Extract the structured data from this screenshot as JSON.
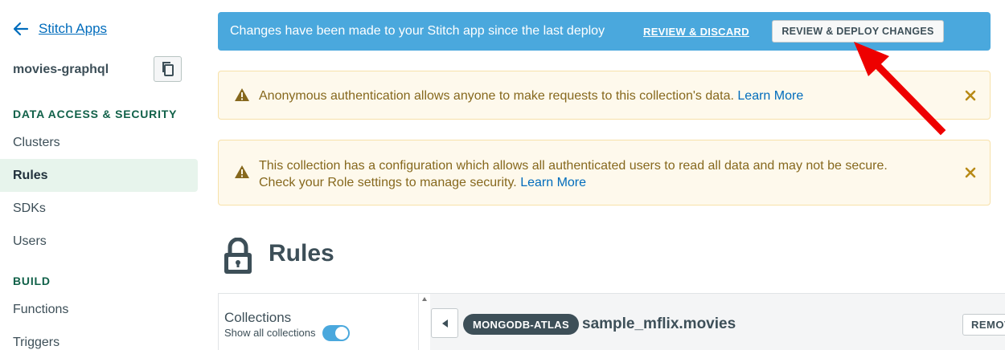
{
  "sidebar": {
    "back_label": "Stitch Apps",
    "app_name": "movies-graphql",
    "sections": [
      {
        "title": "DATA ACCESS & SECURITY",
        "items": [
          {
            "label": "Clusters"
          },
          {
            "label": "Rules",
            "active": true
          },
          {
            "label": "SDKs"
          },
          {
            "label": "Users"
          }
        ]
      },
      {
        "title": "BUILD",
        "items": [
          {
            "label": "Functions"
          },
          {
            "label": "Triggers"
          }
        ]
      }
    ]
  },
  "deploy_banner": {
    "message": "Changes have been made to your Stitch app since the last deploy",
    "review_discard_label": "REVIEW & DISCARD",
    "review_deploy_label": "REVIEW & DEPLOY CHANGES"
  },
  "warnings": [
    {
      "text": "Anonymous authentication allows anyone to make requests to this collection's data.",
      "link": "Learn More"
    },
    {
      "text_line1": "This collection has a configuration which allows all authenticated users to read all data and may not be secure.",
      "text_line2": "Check your Role settings to manage security.",
      "link": "Learn More"
    }
  ],
  "main": {
    "title": "Rules"
  },
  "collections_panel": {
    "title": "Collections",
    "show_all_label": "Show all collections",
    "show_all_enabled": true
  },
  "detail": {
    "service_badge": "MONGODB-ATLAS",
    "collection_name": "sample_mflix.movies",
    "remove_label": "REMOVE"
  },
  "colors": {
    "banner_bg": "#4aa8dd",
    "warning_bg": "#fef9ec",
    "warning_text": "#86681d",
    "link": "#006cbc",
    "section_title": "#116149",
    "active_nav_bg": "#e7f4ec",
    "annotation_arrow": "#ee0000"
  }
}
